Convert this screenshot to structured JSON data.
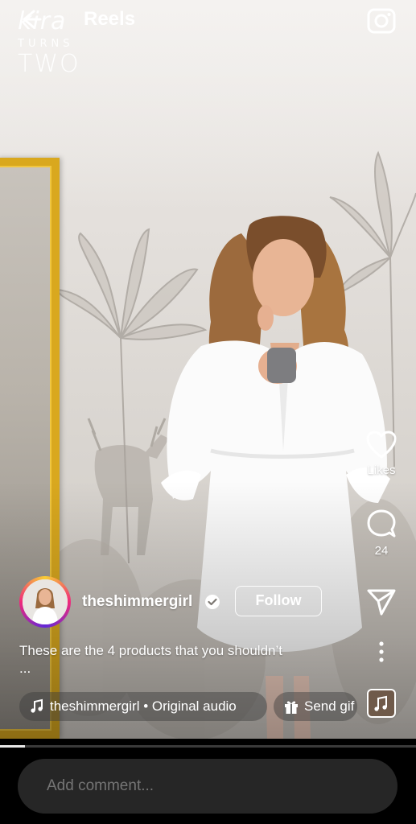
{
  "header": {
    "title": "Reels",
    "back_icon": "arrow-left-icon",
    "camera_icon": "camera-icon"
  },
  "brand": {
    "word": "kira",
    "line1": "TURNS",
    "line2": "TWO"
  },
  "actions": {
    "like": {
      "icon": "heart-icon",
      "label": "Likes"
    },
    "comment": {
      "icon": "comment-bubble-icon",
      "count": "24"
    },
    "share": {
      "icon": "paper-plane-icon"
    },
    "more": {
      "icon": "more-vertical-icon"
    }
  },
  "post": {
    "username": "theshimmergirl",
    "verified": true,
    "follow_label": "Follow",
    "caption": "These are the 4 products that you shouldn’t",
    "caption_more": "..."
  },
  "audio": {
    "icon": "music-note-icon",
    "label": "theshimmergirl • Original audio"
  },
  "gift": {
    "icon": "gift-icon",
    "label": "Send gif"
  },
  "playback": {
    "progress": 0.06
  },
  "comment": {
    "placeholder": "Add comment..."
  },
  "colors": {
    "accent_frame": "#d9a81e",
    "comment_bg": "#262626",
    "background": "#000000"
  }
}
